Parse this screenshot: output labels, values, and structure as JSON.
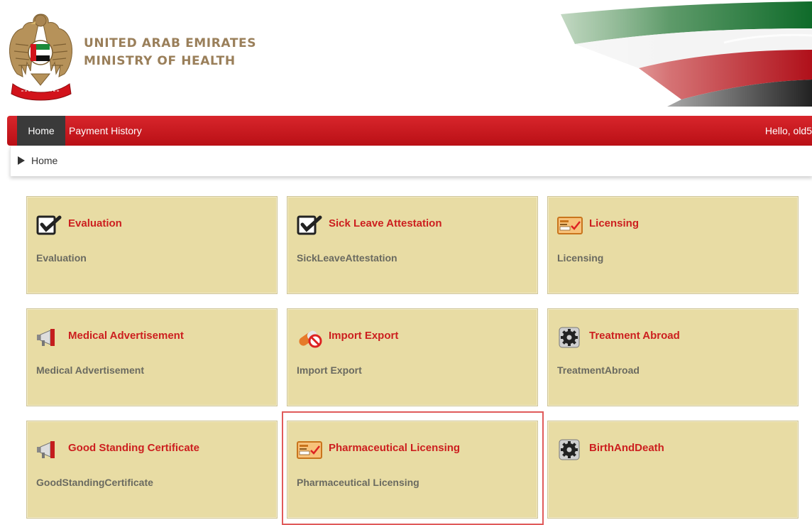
{
  "header": {
    "org_line1": "UNITED ARAB EMIRATES",
    "org_line2": "MINISTRY OF HEALTH"
  },
  "nav": {
    "home": "Home",
    "payment_history": "Payment History",
    "greeting": "Hello, old5"
  },
  "breadcrumb": {
    "current": "Home"
  },
  "colors": {
    "nav_red": "#c8161c",
    "tile_bg": "#e8dca4",
    "tile_title": "#cc1f1f",
    "highlight": "#e05a5a"
  },
  "tiles": [
    {
      "title": "Evaluation",
      "desc": "Evaluation",
      "icon": "checkbox-icon"
    },
    {
      "title": "Sick Leave Attestation",
      "desc": "SickLeaveAttestation",
      "icon": "checkbox-icon"
    },
    {
      "title": "Licensing",
      "desc": "Licensing",
      "icon": "license-card-icon"
    },
    {
      "title": "Medical Advertisement",
      "desc": "Medical Advertisement",
      "icon": "megaphone-icon"
    },
    {
      "title": "Import Export",
      "desc": "Import Export",
      "icon": "pill-forbidden-icon"
    },
    {
      "title": "Treatment Abroad",
      "desc": "TreatmentAbroad",
      "icon": "gear-icon"
    },
    {
      "title": "Good Standing Certificate",
      "desc": "GoodStandingCertificate",
      "icon": "megaphone-icon"
    },
    {
      "title": "Pharmaceutical Licensing",
      "desc": "Pharmaceutical Licensing",
      "icon": "license-card-icon"
    },
    {
      "title": "BirthAndDeath",
      "desc": "",
      "icon": "gear-icon"
    }
  ]
}
